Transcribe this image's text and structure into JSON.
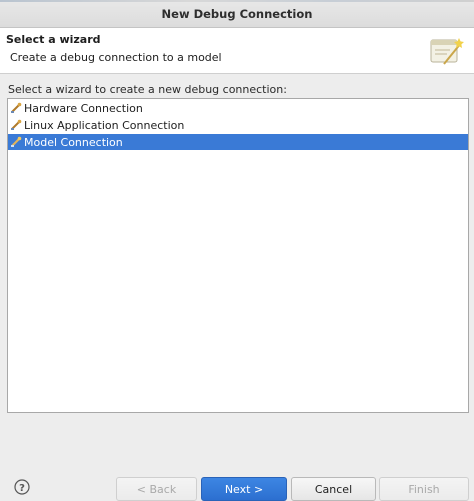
{
  "window": {
    "title": "New Debug Connection"
  },
  "header": {
    "title": "Select a wizard",
    "description": "Create a debug connection to a model",
    "banner_icon": "wizard-banner-icon"
  },
  "prompt": "Select a wizard to create a new debug connection:",
  "wizards": [
    {
      "label": "Hardware Connection",
      "icon": "debug-connection-icon",
      "selected": false
    },
    {
      "label": "Linux Application Connection",
      "icon": "debug-connection-icon",
      "selected": false
    },
    {
      "label": "Model Connection",
      "icon": "debug-connection-icon",
      "selected": true
    }
  ],
  "footer": {
    "help_icon": "help-icon",
    "back_label": "< Back",
    "next_label": "Next >",
    "cancel_label": "Cancel",
    "finish_label": "Finish"
  },
  "colors": {
    "selection": "#3a7ad6",
    "primary_button": "#2c6fd0"
  }
}
